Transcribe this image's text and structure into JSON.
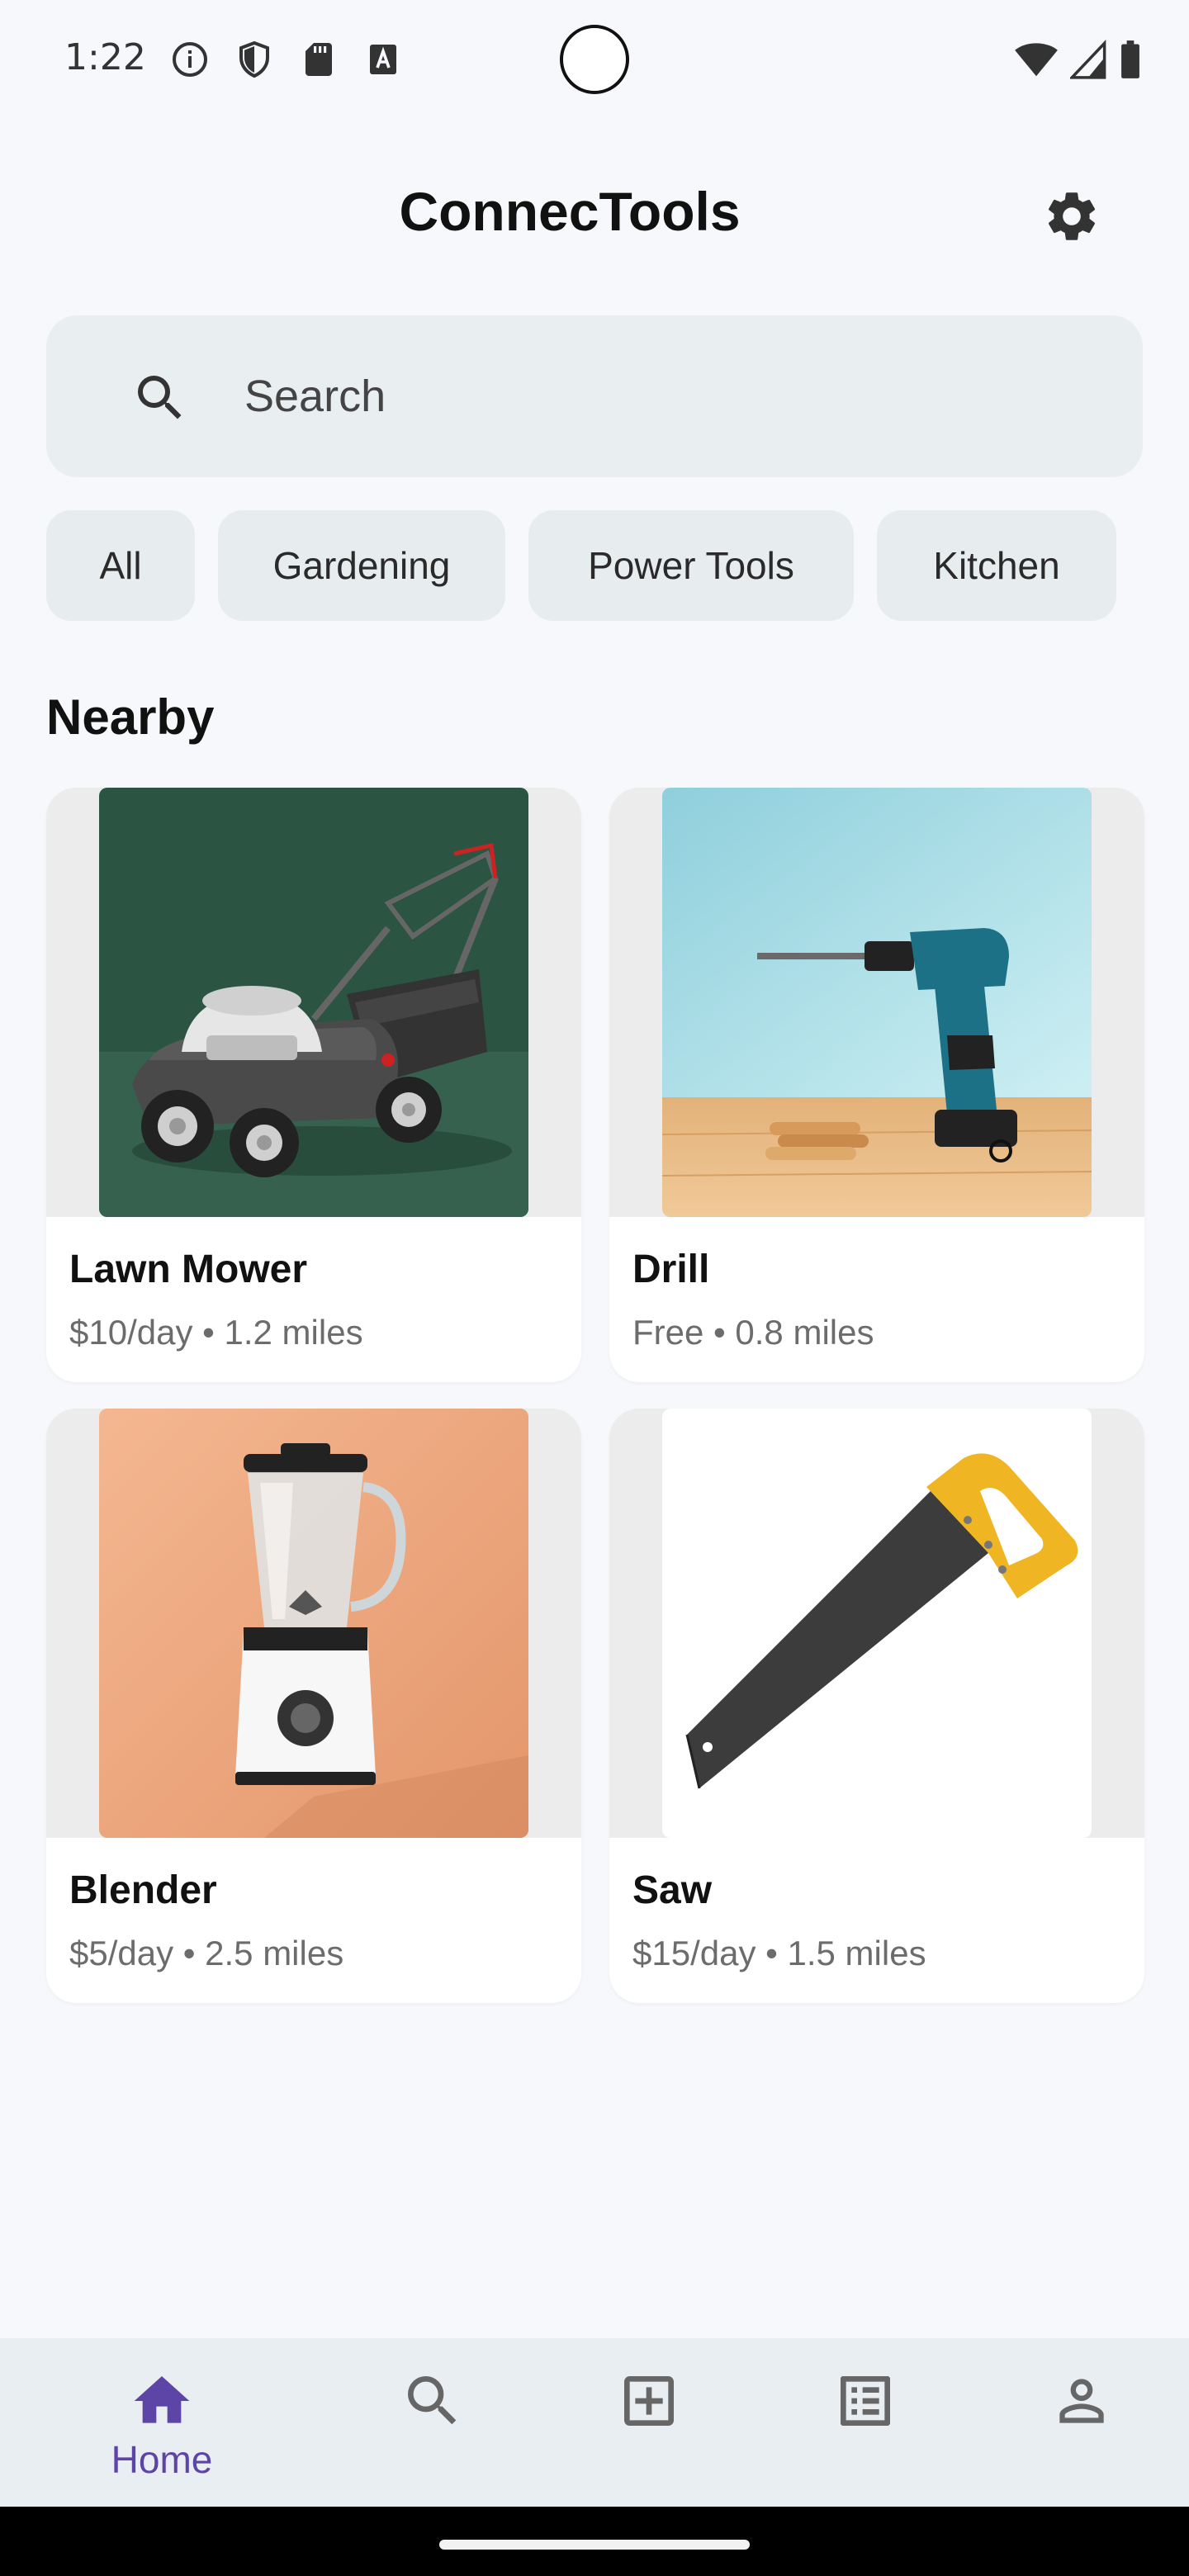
{
  "status_bar": {
    "time": "1:22",
    "left_icons": [
      "info-icon",
      "shield-icon",
      "sd-card-icon",
      "a-icon"
    ],
    "right_icons": [
      "wifi-icon",
      "signal-icon",
      "battery-icon"
    ]
  },
  "header": {
    "title": "ConnecTools",
    "settings_icon": "gear-icon"
  },
  "search": {
    "placeholder": "Search",
    "value": ""
  },
  "categories": [
    {
      "label": "All"
    },
    {
      "label": "Gardening"
    },
    {
      "label": "Power Tools"
    },
    {
      "label": "Kitchen"
    }
  ],
  "section": {
    "title": "Nearby"
  },
  "items": [
    {
      "name": "Lawn Mower",
      "detail": "$10/day • 1.2 miles"
    },
    {
      "name": "Drill",
      "detail": "Free • 0.8 miles"
    },
    {
      "name": "Blender",
      "detail": "$5/day • 2.5 miles"
    },
    {
      "name": "Saw",
      "detail": "$15/day • 1.5 miles"
    }
  ],
  "bottom_nav": {
    "home_label": "Home",
    "icons": [
      "home-icon",
      "search-icon",
      "add-box-icon",
      "list-icon",
      "person-icon"
    ],
    "active_color": "#5d45a8"
  },
  "colors": {
    "background": "#f6f8fb",
    "chip_background": "#e7edef",
    "accent": "#5d45a8"
  }
}
